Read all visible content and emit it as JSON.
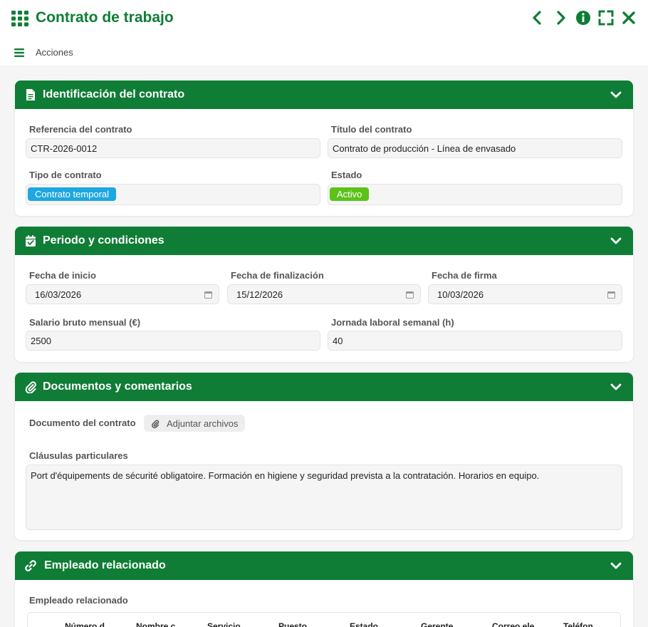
{
  "window": {
    "title": "Contrato de trabajo",
    "menu_label": "Acciones",
    "brand_color": "#0f7d35",
    "icons": [
      "grid-icon",
      "chevron-left-icon",
      "chevron-right-icon",
      "info-icon",
      "fullscreen-icon",
      "close-icon",
      "menu-icon"
    ]
  },
  "sections": {
    "identificacion": {
      "title": "Identificación del contrato",
      "icon": "document-icon",
      "referencia_label": "Referencia del contrato",
      "referencia_value": "CTR-2026-0012",
      "titulo_label": "Título del contrato",
      "titulo_value": "Contrato de producción - Línea de envasado",
      "tipo_label": "Tipo de contrato",
      "tipo_value": "Contrato temporal",
      "tipo_color": "#1ea7e1",
      "estado_label": "Estado",
      "estado_value": "Activo",
      "estado_color": "#5cc21a"
    },
    "periodo": {
      "title": "Periodo y condiciones",
      "icon": "calendar-check-icon",
      "inicio_label": "Fecha de inicio",
      "inicio_value": "16/03/2026",
      "fin_label": "Fecha de finalización",
      "fin_value": "15/12/2026",
      "firma_label": "Fecha de firma",
      "firma_value": "10/03/2026",
      "salario_label": "Salario bruto mensual (€)",
      "salario_value": "2500",
      "jornada_label": "Jornada laboral semanal (h)",
      "jornada_value": "40"
    },
    "documentos": {
      "title": "Documentos y comentarios",
      "icon": "paperclip-icon",
      "documento_label": "Documento del contrato",
      "adjuntar_label": "Adjuntar archivos",
      "clausulas_label": "Cláusulas particulares",
      "clausulas_value": "Port d'équipements de sécurité obligatoire. Formación en higiene y seguridad prevista a la contratación. Horarios en equipo."
    },
    "empleado": {
      "title": "Empleado relacionado",
      "icon": "link-icon",
      "field_label": "Empleado relacionado",
      "columns": [
        "",
        "Número d",
        "Nombre c",
        "Servicio",
        "Puesto",
        "Estado",
        "Gerente",
        "Correo ele",
        "Teléfon"
      ]
    }
  }
}
